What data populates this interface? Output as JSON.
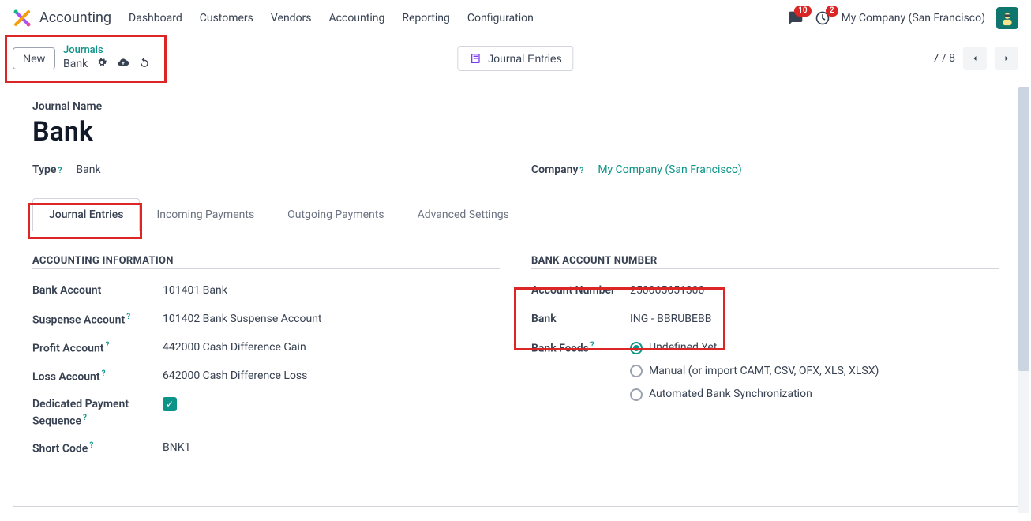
{
  "navbar": {
    "app_title": "Accounting",
    "menu": [
      "Dashboard",
      "Customers",
      "Vendors",
      "Accounting",
      "Reporting",
      "Configuration"
    ],
    "messages_badge": "10",
    "activities_badge": "2",
    "company": "My Company (San Francisco)"
  },
  "control_panel": {
    "new_label": "New",
    "breadcrumb_top": "Journals",
    "breadcrumb_name": "Bank",
    "center_button": "Journal Entries",
    "pager": "7 / 8"
  },
  "form": {
    "name_label": "Journal Name",
    "name_value": "Bank",
    "type_label": "Type",
    "type_value": "Bank",
    "company_label": "Company",
    "company_value": "My Company (San Francisco)",
    "tabs": [
      "Journal Entries",
      "Incoming Payments",
      "Outgoing Payments",
      "Advanced Settings"
    ],
    "left_section_title": "ACCOUNTING INFORMATION",
    "right_section_title": "BANK ACCOUNT NUMBER",
    "left_fields": {
      "bank_account_label": "Bank Account",
      "bank_account_value": "101401 Bank",
      "suspense_label": "Suspense Account",
      "suspense_value": "101402 Bank Suspense Account",
      "profit_label": "Profit Account",
      "profit_value": "442000 Cash Difference Gain",
      "loss_label": "Loss Account",
      "loss_value": "642000 Cash Difference Loss",
      "dedicated_label": "Dedicated Payment Sequence",
      "short_code_label": "Short Code",
      "short_code_value": "BNK1"
    },
    "right_fields": {
      "account_number_label": "Account Number",
      "account_number_value": "250065651300",
      "bank_label": "Bank",
      "bank_value": "ING - BBRUBEBB",
      "bank_feeds_label": "Bank Feeds",
      "bank_feeds_options": [
        "Undefined Yet",
        "Manual (or import CAMT, CSV, OFX, XLS, XLSX)",
        "Automated Bank Synchronization"
      ]
    }
  }
}
